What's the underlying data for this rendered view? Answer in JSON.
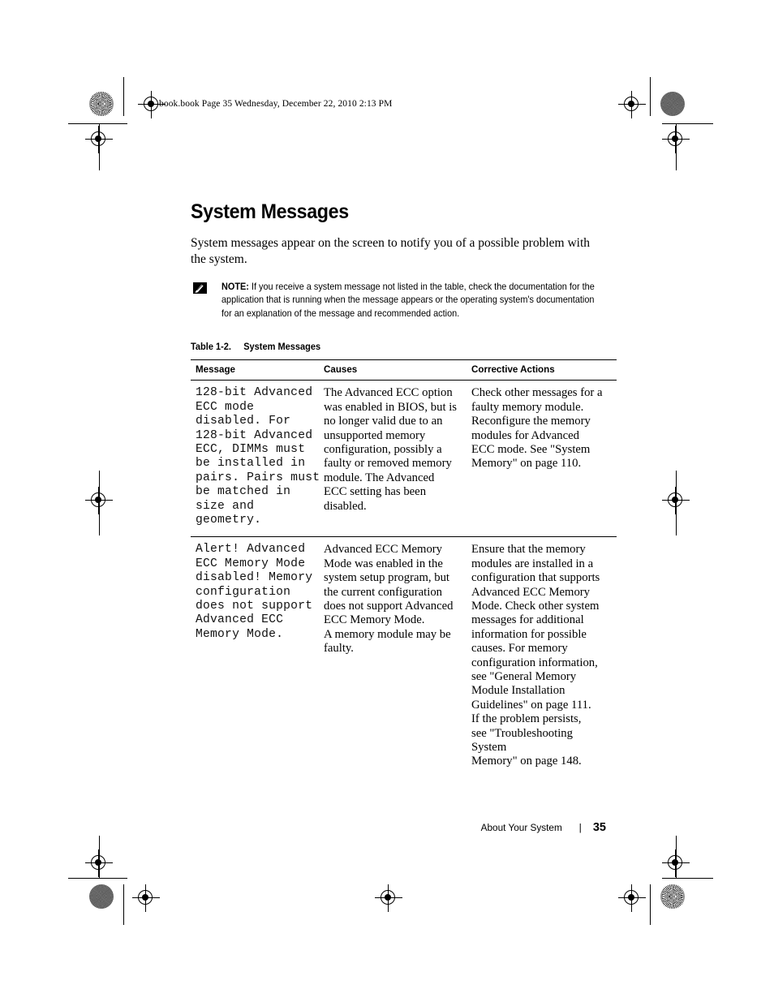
{
  "running_header": "book.book  Page 35  Wednesday, December 22, 2010  2:13 PM",
  "page_title": "System Messages",
  "intro": "System messages appear on the screen to notify you of a possible problem with the system.",
  "note": {
    "icon": "note-pencil-icon",
    "label": "NOTE:",
    "text": " If you receive a system message not listed in the table, check the documentation for the application that is running when the message appears or the operating system's documentation for an explanation of the message and recommended action."
  },
  "table": {
    "caption_number": "Table 1-2.",
    "caption_title": "System Messages",
    "headers": [
      "Message",
      "Causes",
      "Corrective Actions"
    ],
    "rows": [
      {
        "message_lines": [
          "128-bit Advanced",
          "ECC mode",
          "disabled. For",
          "128-bit Advanced",
          "ECC, DIMMs must",
          "be installed in",
          "pairs. Pairs must",
          "be matched in",
          "size and",
          "geometry."
        ],
        "cause_lines": [
          "The Advanced ECC option",
          "was enabled in BIOS, but is",
          "no longer valid due to an",
          "unsupported memory",
          "configuration, possibly a",
          "faulty or removed memory",
          "module. The Advanced",
          "ECC setting has been",
          "disabled."
        ],
        "action_lines": [
          "Check other messages for a",
          "faulty memory module.",
          "Reconfigure the memory",
          "modules for Advanced",
          "ECC mode. See \"System",
          "Memory\" on page 110."
        ]
      },
      {
        "message_lines": [
          "Alert! Advanced",
          "ECC Memory Mode",
          "disabled! Memory",
          "configuration",
          "does not support",
          "Advanced ECC",
          "Memory Mode."
        ],
        "cause_lines": [
          "Advanced ECC Memory",
          "Mode was enabled in the",
          "system setup program, but",
          "the current configuration",
          "does not support Advanced",
          "ECC Memory Mode.",
          "A memory module may be",
          "faulty."
        ],
        "action_lines": [
          "Ensure that the memory",
          "modules are installed in a",
          "configuration that supports",
          "Advanced ECC Memory",
          "Mode. Check other system",
          "messages for additional",
          "information for possible",
          "causes. For memory",
          "configuration information,",
          "see \"General Memory",
          "Module Installation",
          "Guidelines\" on page 111.",
          "If the problem persists,",
          "see \"Troubleshooting System",
          "Memory\" on page 148."
        ]
      }
    ]
  },
  "footer": {
    "section": "About Your System",
    "separator": "|",
    "page_number": "35"
  }
}
